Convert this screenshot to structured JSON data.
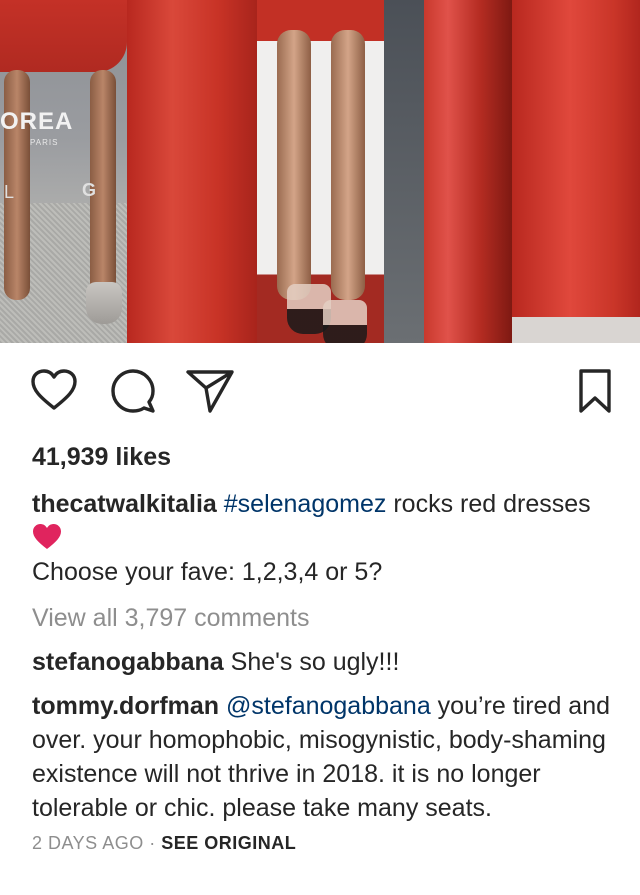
{
  "photo": {
    "brand_text": "OREA",
    "brand_sub": "PARIS",
    "brand_letter_left": "L",
    "brand_letter_right": "G"
  },
  "actions": {
    "like_icon": "heart-outline-icon",
    "comment_icon": "comment-bubble-icon",
    "share_icon": "paper-plane-icon",
    "save_icon": "bookmark-outline-icon"
  },
  "post": {
    "likes": "41,939 likes",
    "caption_user": "thecatwalkitalia",
    "caption_hashtag": "#selenagomez",
    "caption_text": " rocks red dresses",
    "caption_line2": "Choose your fave: 1,2,3,4 or 5?",
    "view_all": "View all 3,797 comments",
    "timestamp": "2 DAYS AGO",
    "separator": "·",
    "see_original": "SEE ORIGINAL"
  },
  "comments": [
    {
      "user": "stefanogabbana",
      "mention": "",
      "text": " She's so ugly!!!"
    },
    {
      "user": "tommy.dorfman",
      "mention": "@stefanogabbana",
      "text": " you’re tired and over. your homophobic, misogynistic, body-shaming existence will not thrive in 2018. it is no longer tolerable or chic. please take many seats."
    }
  ],
  "colors": {
    "text": "#262626",
    "link": "#003569",
    "muted": "#8e8e8e",
    "heart_emoji": "#e0245e",
    "dress_red": "#c9342a"
  }
}
